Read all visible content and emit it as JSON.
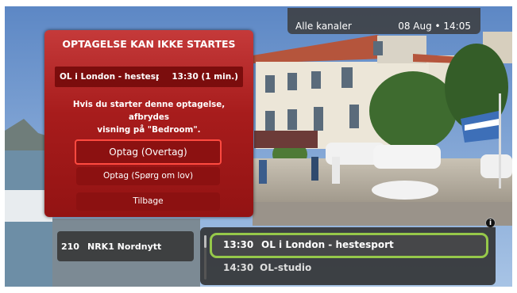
{
  "header": {
    "channel_filter": "Alle kanaler",
    "datetime": "08 Aug • 14:05"
  },
  "dialog": {
    "title": "OPTAGELSE KAN IKKE STARTES",
    "program": "OL i London - hestesport",
    "time": "13:30 (1 min.)",
    "message_line1": "Hvis du starter denne optagelse, afbrydes",
    "message_line2": "visning på \"Bedroom\".",
    "buttons": [
      "Optag (Overtag)",
      "Optag (Spørg om lov)",
      "Tilbage"
    ]
  },
  "channel": {
    "number": "210",
    "name": "NRK1 Nordnytt"
  },
  "epg": [
    {
      "time": "13:30",
      "title": "OL i London - hestesport"
    },
    {
      "time": "14:30",
      "title": "OL-studio"
    }
  ],
  "info_icon": "info-icon",
  "colors": {
    "dialog_red": "#a71c1c",
    "focus_red": "#ff4a40",
    "focus_green": "#96c84a"
  }
}
